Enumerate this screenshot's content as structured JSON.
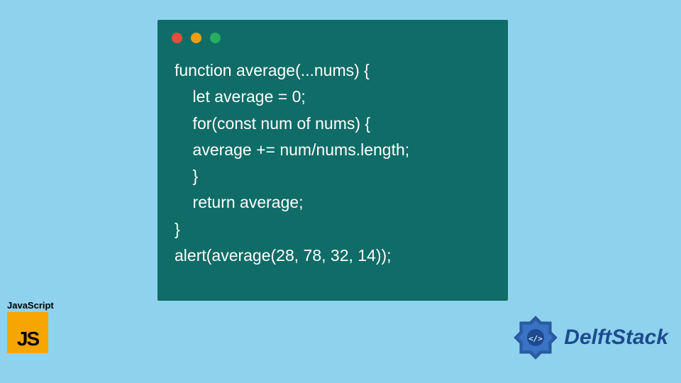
{
  "code": {
    "lines": [
      "function average(...nums) {",
      "    let average = 0;",
      "    for(const num of nums) {",
      "    average += num/nums.length;",
      "    }",
      "    return average;",
      "}",
      "alert(average(28, 78, 32, 14));"
    ]
  },
  "logos": {
    "js_label": "JavaScript",
    "js_badge_text": "JS",
    "delftstack_text": "DelftStack"
  },
  "colors": {
    "background": "#8fd2ee",
    "code_window": "#0f6c67",
    "code_text": "#ffffff",
    "js_badge": "#f7a500",
    "delftstack": "#1d4b8f",
    "dot_red": "#e74c3c",
    "dot_yellow": "#f39c12",
    "dot_green": "#27ae60"
  }
}
